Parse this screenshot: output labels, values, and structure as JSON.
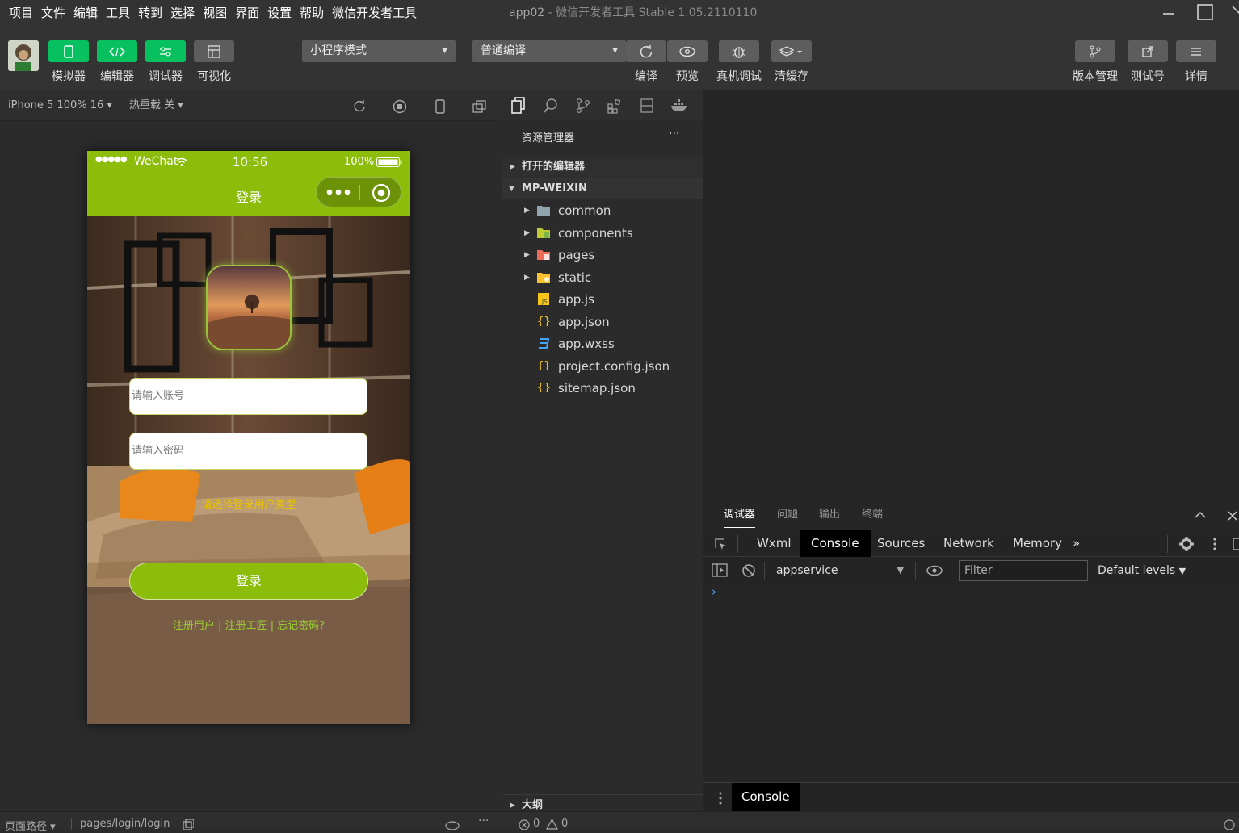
{
  "menubar": {
    "items": [
      "项目",
      "文件",
      "编辑",
      "工具",
      "转到",
      "选择",
      "视图",
      "界面",
      "设置",
      "帮助",
      "微信开发者工具"
    ],
    "title_app": "app02",
    "title_sep": "-",
    "title_rest": "微信开发者工具 Stable 1.05.2110110"
  },
  "toolbar": {
    "left_buttons": [
      "模拟器",
      "编辑器",
      "调试器",
      "可视化"
    ],
    "mode_select": "小程序模式",
    "compile_select": "普通编译",
    "mid_buttons": [
      "编译",
      "预览",
      "真机调试",
      "清缓存"
    ],
    "right_buttons": [
      "版本管理",
      "测试号",
      "详情"
    ]
  },
  "simulator": {
    "device": "iPhone 5 100% 16",
    "device_arrow": "▾",
    "hot_reload": "热重载 关",
    "hot_reload_arrow": "▾",
    "statusbar": {
      "signal": "●●●●●",
      "carrier": "WeChat",
      "time": "10:56",
      "battery": "100%"
    },
    "nav_title": "登录",
    "account_placeholder": "请输入账号",
    "password_placeholder": "请输入密码",
    "user_type_prompt": "请选择登录用户类型",
    "login_button": "登录",
    "links": [
      "注册用户",
      "注册工匠",
      "忘记密码?"
    ],
    "link_sep": "|"
  },
  "explorer": {
    "title": "资源管理器",
    "more": "···",
    "open_editors": "打开的编辑器",
    "project": "MP-WEIXIN",
    "items": [
      {
        "name": "common",
        "type": "folder-icon"
      },
      {
        "name": "components",
        "type": "components-folder-icon"
      },
      {
        "name": "pages",
        "type": "pages-folder-icon"
      },
      {
        "name": "static",
        "type": "static-folder-icon"
      },
      {
        "name": "app.js",
        "type": "js-file-icon"
      },
      {
        "name": "app.json",
        "type": "json-file-icon"
      },
      {
        "name": "app.wxss",
        "type": "css-file-icon"
      },
      {
        "name": "project.config.json",
        "type": "json-file-icon"
      },
      {
        "name": "sitemap.json",
        "type": "json-file-icon"
      }
    ],
    "outline": "大纲"
  },
  "devtools": {
    "tabs": [
      "调试器",
      "问题",
      "输出",
      "终端"
    ],
    "panel_tabs": [
      "Wxml",
      "Console",
      "Sources",
      "Network",
      "Memory"
    ],
    "more_tabs": "»",
    "context": "appservice",
    "filter_placeholder": "Filter",
    "levels": "Default levels",
    "levels_arrow": "▼",
    "prompt": "›",
    "drawer_tab": "Console"
  },
  "bottombar": {
    "path_label": "页面路径",
    "path_arrow": "▾",
    "path": "pages/login/login",
    "errors": "0",
    "warnings": "0"
  },
  "colors": {
    "accent_green": "#07c160",
    "wechat_nav": "#8bbd0a",
    "link_green": "#9acd32",
    "prompt_yellow": "#e8c400"
  }
}
